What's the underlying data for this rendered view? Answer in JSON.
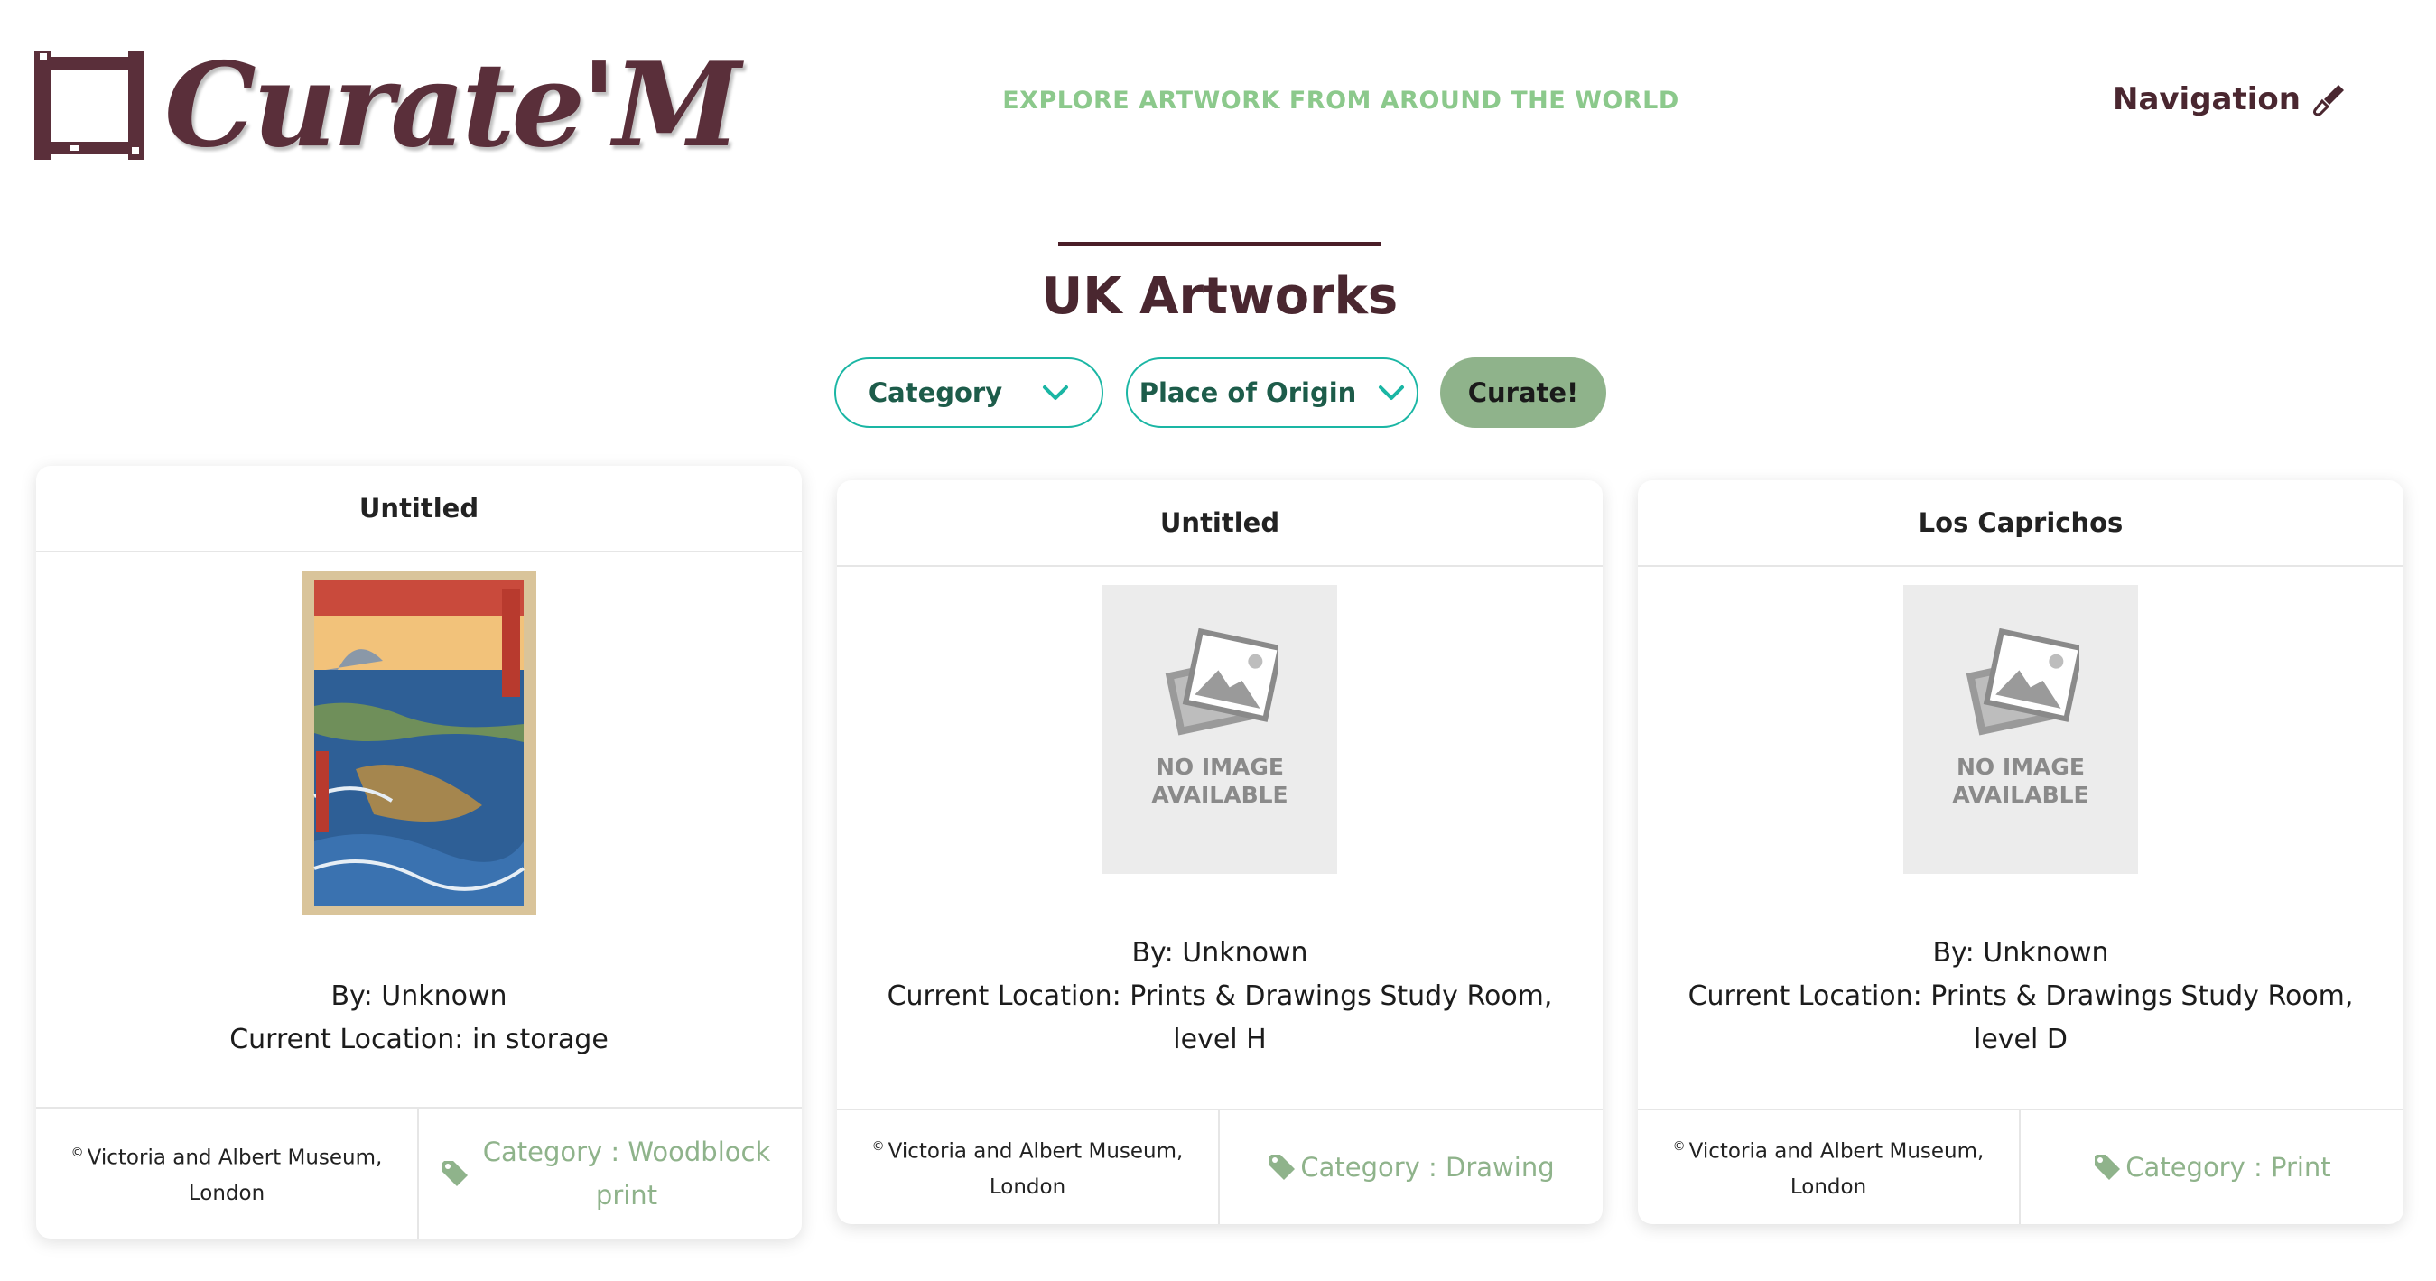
{
  "header": {
    "logo_text": "Curate'M",
    "tagline": "EXPLORE ARTWORK FROM AROUND THE WORLD",
    "nav_label": "Navigation",
    "nav_icon": "paintbrush-icon"
  },
  "page": {
    "title": "UK Artworks"
  },
  "filters": {
    "category_label": "Category",
    "origin_label": "Place of Origin",
    "curate_label": "Curate!"
  },
  "colors": {
    "brand": "#5a2f3a",
    "tagline": "#8cc98c",
    "dropdown_border": "#1ab6a4",
    "curate_button": "#8fb38b",
    "category_text": "#8fb38b"
  },
  "artworks": [
    {
      "title": "Untitled",
      "by": "By: Unknown",
      "location": "Current Location: in storage",
      "credit": "Victoria and Albert Museum, London",
      "category": "Category : Woodblock print",
      "has_image": true
    },
    {
      "title": "Untitled",
      "by": "By: Unknown",
      "location": "Current Location: Prints & Drawings Study Room, level H",
      "credit": "Victoria and Albert Museum, London",
      "category": "Category : Drawing",
      "has_image": false,
      "no_image_text": "NO IMAGE AVAILABLE"
    },
    {
      "title": "Los Caprichos",
      "by": "By: Unknown",
      "location": "Current Location: Prints & Drawings Study Room, level D",
      "credit": "Victoria and Albert Museum, London",
      "category": "Category : Print",
      "has_image": false,
      "no_image_text": "NO IMAGE AVAILABLE"
    }
  ]
}
